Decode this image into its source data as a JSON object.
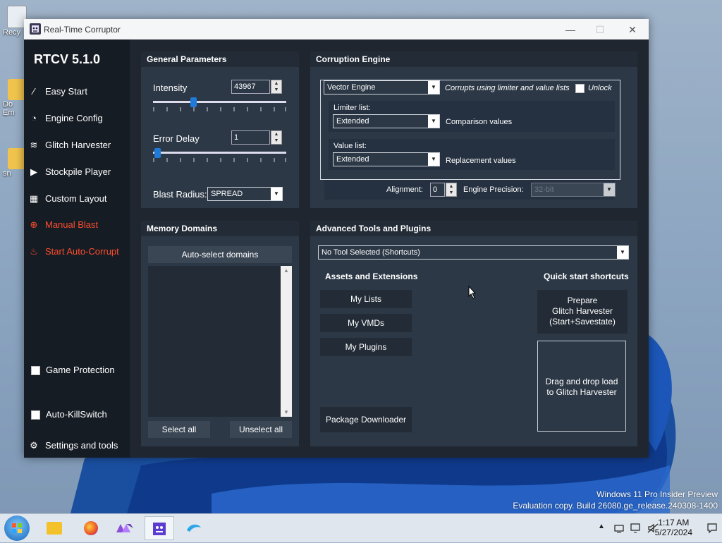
{
  "desktop": {
    "icons": [
      "Recy",
      "Do\nEm",
      "sn"
    ],
    "watermark_line1": "Windows 11 Pro Insider Preview",
    "watermark_line2": "Evaluation copy. Build 26080.ge_release.240308-1400"
  },
  "window": {
    "title": "Real-Time Corruptor",
    "minimize": "—",
    "maximize": "☐",
    "close": "✕"
  },
  "sidebar": {
    "version": "RTCV 5.1.0",
    "items": [
      {
        "label": "Easy Start",
        "icon": "wand-icon"
      },
      {
        "label": "Engine Config",
        "icon": "gauge-icon"
      },
      {
        "label": "Glitch Harvester",
        "icon": "layers-icon"
      },
      {
        "label": "Stockpile Player",
        "icon": "play-icon"
      },
      {
        "label": "Custom Layout",
        "icon": "grid-icon"
      },
      {
        "label": "Manual Blast",
        "icon": "crosshair-icon"
      },
      {
        "label": "Start Auto-Corrupt",
        "icon": "flame-icon"
      }
    ],
    "game_protection": "Game Protection",
    "auto_killswitch": "Auto-KillSwitch",
    "settings": "Settings and tools"
  },
  "general": {
    "header": "General Parameters",
    "intensity_label": "Intensity",
    "intensity_value": "43967",
    "error_delay_label": "Error Delay",
    "error_delay_value": "1",
    "blast_radius_label": "Blast Radius:",
    "blast_radius_value": "SPREAD"
  },
  "engine": {
    "header": "Corruption Engine",
    "engine_value": "Vector Engine",
    "engine_desc": "Corrupts using limiter and value lists",
    "unlock_label": "Unlock",
    "limiter_label": "Limiter list:",
    "limiter_value": "Extended",
    "limiter_desc": "Comparison values",
    "value_label": "Value list:",
    "value_value": "Extended",
    "value_desc": "Replacement values",
    "alignment_label": "Alignment:",
    "alignment_value": "0",
    "precision_label": "Engine Precision:",
    "precision_value": "32-bit"
  },
  "memory": {
    "header": "Memory Domains",
    "auto_select": "Auto-select domains",
    "select_all": "Select all",
    "unselect_all": "Unselect all"
  },
  "tools": {
    "header": "Advanced Tools and Plugins",
    "tool_select": "No Tool Selected (Shortcuts)",
    "assets_header": "Assets and Extensions",
    "quick_header": "Quick start shortcuts",
    "my_lists": "My Lists",
    "my_vmds": "My VMDs",
    "my_plugins": "My Plugins",
    "package_downloader": "Package Downloader",
    "prepare_line1": "Prepare",
    "prepare_line2": "Glitch Harvester",
    "prepare_line3": "(Start+Savestate)",
    "drag_line1": "Drag and drop load",
    "drag_line2": "to Glitch Harvester"
  },
  "taskbar": {
    "time": "1:17 AM",
    "date": "5/27/2024",
    "tray_up": "▲"
  }
}
